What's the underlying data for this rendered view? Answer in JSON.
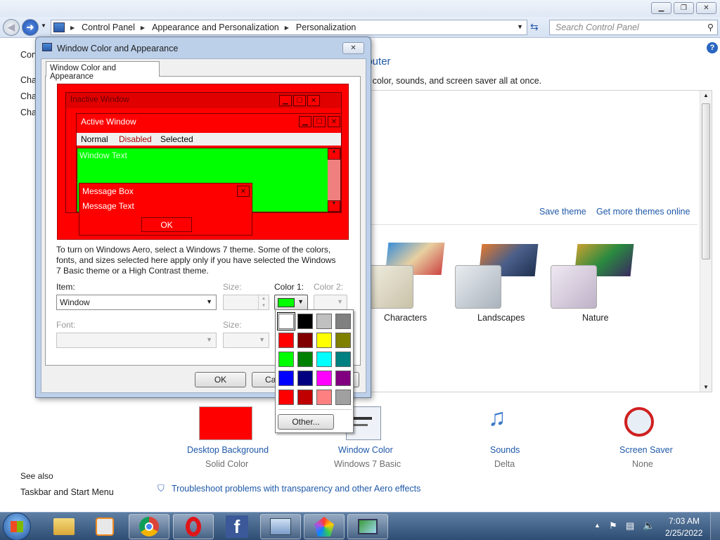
{
  "explorer": {
    "address": {
      "root": "Control Panel",
      "mid": "Appearance and Personalization",
      "leaf": "Personalization"
    },
    "search_placeholder": "Search Control Panel",
    "left_nav": {
      "home": "Con",
      "items": [
        "Cha",
        "Cha",
        "Cha"
      ],
      "see_also": "See also",
      "taskbar": "Taskbar and Start Menu"
    },
    "main": {
      "heading_fragment": "nputer",
      "description_fragment": "v color, sounds, and screen saver all at once.",
      "save_theme": "Save theme",
      "get_more": "Get more themes online",
      "themes": [
        "Characters",
        "Landscapes",
        "Nature"
      ],
      "bottom": [
        {
          "label": "Desktop Background",
          "sub": "Solid Color"
        },
        {
          "label": "Window Color",
          "sub": "Windows 7 Basic"
        },
        {
          "label": "Sounds",
          "sub": "Delta"
        },
        {
          "label": "Screen Saver",
          "sub": "None"
        }
      ],
      "troubleshoot": "Troubleshoot problems with transparency and other Aero effects"
    }
  },
  "dialog": {
    "title": "Window Color and Appearance",
    "tab": "Window Color and Appearance",
    "preview": {
      "inactive": "Inactive Window",
      "active": "Active Window",
      "menu": [
        "Normal",
        "Disabled",
        "Selected"
      ],
      "window_text": "Window Text",
      "message_box": "Message Box",
      "message_text": "Message Text",
      "ok": "OK"
    },
    "info": "To turn on Windows Aero, select a Windows 7 theme.  Some of the colors, fonts, and sizes selected here apply only if you have selected the Windows 7 Basic theme or a High Contrast theme.",
    "item_label": "Item:",
    "item_value": "Window",
    "size_label": "Size:",
    "color1_label": "Color 1:",
    "color2_label": "Color 2:",
    "font_label": "Font:",
    "size2_label": "Size:",
    "ok": "OK",
    "cancel": "Ca"
  },
  "picker": {
    "colors": [
      "#ffffff",
      "#000000",
      "#c0c0c0",
      "#808080",
      "#ff0000",
      "#800000",
      "#ffff00",
      "#808000",
      "#00ff00",
      "#008000",
      "#00ffff",
      "#008080",
      "#0000ff",
      "#000080",
      "#ff00ff",
      "#800080",
      "#ff0000",
      "#c00000",
      "#ff8080",
      "#a0a0a0"
    ],
    "other": "Other..."
  },
  "taskbar": {
    "time": "7:03 AM",
    "date": "2/25/2022"
  },
  "colors": {
    "accent_red": "#ff0000",
    "window_green": "#00ff00",
    "link_blue": "#1e58a8"
  }
}
